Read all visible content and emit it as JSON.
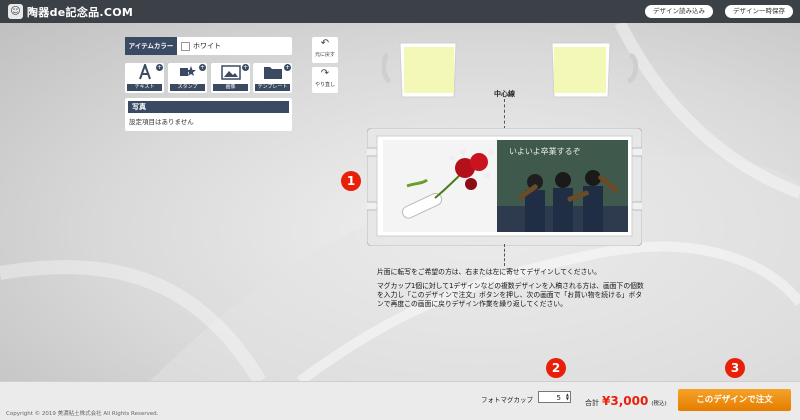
{
  "header": {
    "logo_text": "陶器de記念品.COM",
    "buttons": [
      "デザイン読み込み",
      "デザイン一時保存"
    ]
  },
  "item_color": {
    "label": "アイテムカラー",
    "value": "ホワイト"
  },
  "tools": [
    {
      "label": "テキスト",
      "icon": "text-icon"
    },
    {
      "label": "スタンプ",
      "icon": "stamp-icon"
    },
    {
      "label": "画像",
      "icon": "image-icon"
    },
    {
      "label": "テンプレート",
      "icon": "folder-icon"
    }
  ],
  "photo_panel": {
    "title": "写真",
    "message": "設定項目はありません"
  },
  "history": {
    "undo_label": "元に戻す",
    "redo_label": "やり直し"
  },
  "canvas": {
    "center_label": "中心線",
    "photo_caption": "いよいよ卒業するぞ"
  },
  "instructions": [
    "片面に転写をご希望の方は、右または左に寄せてデザインしてください。",
    "マグカップ1個に対して1デザインなどの複数デザインを入稿される方は、画面下の個数を入力し「このデザインで注文」ボタンを押し、次の画面で「お買い物を続ける」ボタンで再度この画面に戻りデザイン作業を繰り返してください。"
  ],
  "markers": [
    "1",
    "2",
    "3"
  ],
  "order": {
    "product_label": "フォトマグカップ",
    "quantity": "5",
    "total_label": "合計",
    "total_price": "¥3,000",
    "tax_note": "(税込)",
    "order_button": "このデザインで注文"
  },
  "footer": {
    "copyright": "Copyright © 2019 美濃粘土株式会社 All Rights Reserved."
  },
  "colors": {
    "topbar": "#3c4148",
    "accent_navy": "#3b4a63",
    "mug_print_area": "#f3f8b6",
    "marker_red": "#e8200a",
    "order_orange": "#f29a1e"
  }
}
